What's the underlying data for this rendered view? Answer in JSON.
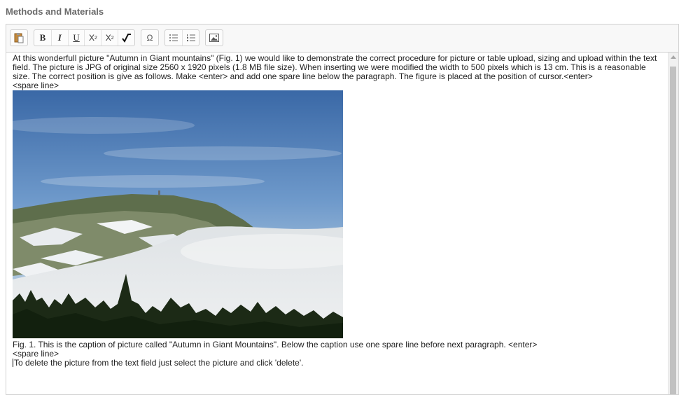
{
  "section": {
    "title": "Methods and Materials"
  },
  "toolbar": {
    "buttons": [
      {
        "name": "paste-icon",
        "glyph": ""
      },
      {
        "name": "bold-button",
        "glyph": "B"
      },
      {
        "name": "italic-button",
        "glyph": "I"
      },
      {
        "name": "underline-button",
        "glyph": "U"
      },
      {
        "name": "subscript-button",
        "glyph": "X₂"
      },
      {
        "name": "superscript-button",
        "glyph": "X²"
      },
      {
        "name": "math-icon",
        "glyph": "√"
      },
      {
        "name": "special-char-button",
        "glyph": "Ω"
      },
      {
        "name": "bullet-list-icon",
        "glyph": ""
      },
      {
        "name": "numbered-list-icon",
        "glyph": ""
      },
      {
        "name": "image-icon",
        "glyph": ""
      }
    ]
  },
  "content": {
    "paragraph": "At this wonderfull picture \"Autumn in Giant mountains\" (Fig. 1) we would like to demonstrate the correct procedure for picture or table upload, sizing and upload within the text field. The picture is JPG of original size 2560 x 1920 pixels (1.8 MB file size). When inserting we were modified the width to 500 pixels which is 13 cm. This is a reasonable size. The correct position is give as follows. Make <enter> and add one spare line below the paragraph. The figure is placed at the position of cursor.<enter>",
    "spare_line_1": "<spare line>",
    "caption": "Fig. 1. This is the caption of picture called \"Autumn in Giant Mountains\". Below the caption use one spare line before next paragraph. <enter>",
    "spare_line_2": "<spare line>",
    "last_line": "To delete the picture from the text field just select the picture and click 'delete'."
  },
  "colors": {
    "sky_top": "#3d6aa8",
    "fog": "#e6e9ec",
    "forest": "#1c2a16"
  }
}
